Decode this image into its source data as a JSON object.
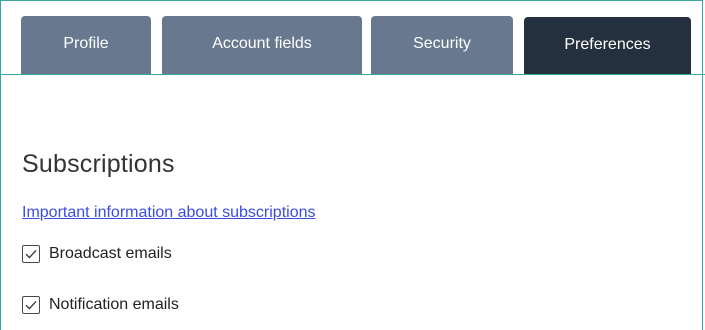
{
  "tabs": [
    {
      "label": "Profile",
      "active": false
    },
    {
      "label": "Account fields",
      "active": false
    },
    {
      "label": "Security",
      "active": false
    },
    {
      "label": "Preferences",
      "active": true
    }
  ],
  "section": {
    "heading": "Subscriptions",
    "info_link": "Important information about subscriptions",
    "options": [
      {
        "label": "Broadcast emails",
        "checked": true
      },
      {
        "label": "Notification emails",
        "checked": true
      }
    ]
  },
  "colors": {
    "tab_inactive": "#68798f",
    "tab_active": "#24303d",
    "accent_border": "#3aa5a0",
    "link": "#3b4de1"
  }
}
